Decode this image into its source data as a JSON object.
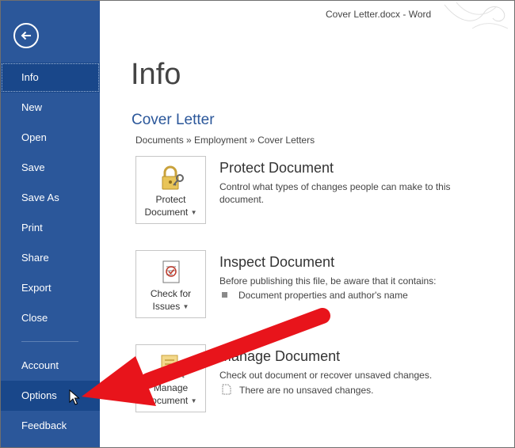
{
  "window": {
    "title": "Cover Letter.docx - Word"
  },
  "sidebar": {
    "items": [
      {
        "label": "Info"
      },
      {
        "label": "New"
      },
      {
        "label": "Open"
      },
      {
        "label": "Save"
      },
      {
        "label": "Save As"
      },
      {
        "label": "Print"
      },
      {
        "label": "Share"
      },
      {
        "label": "Export"
      },
      {
        "label": "Close"
      },
      {
        "label": "Account"
      },
      {
        "label": "Options"
      },
      {
        "label": "Feedback"
      }
    ]
  },
  "main": {
    "title": "Info",
    "doc_name": "Cover Letter",
    "breadcrumb": "Documents » Employment » Cover Letters",
    "sections": [
      {
        "tile_line1": "Protect",
        "tile_line2": "Document",
        "title": "Protect Document",
        "desc": "Control what types of changes people can make to this document."
      },
      {
        "tile_line1": "Check for",
        "tile_line2": "Issues",
        "title": "Inspect Document",
        "desc": "Before publishing this file, be aware that it contains:",
        "items": [
          "Document properties and author's name"
        ]
      },
      {
        "tile_line1": "Manage",
        "tile_line2": "Document",
        "title": "Manage Document",
        "desc": "Check out document or recover unsaved changes.",
        "items": [
          "There are no unsaved changes."
        ]
      }
    ]
  },
  "colors": {
    "sidebar": "#2b579a",
    "accent": "#2b579a",
    "arrow": "#e8141b"
  }
}
